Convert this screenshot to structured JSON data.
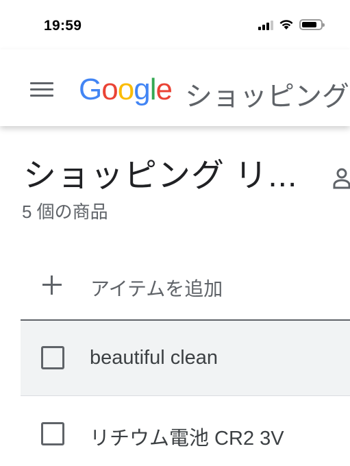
{
  "status_bar": {
    "time": "19:59"
  },
  "app_bar": {
    "logo_letters": [
      "G",
      "o",
      "o",
      "g",
      "l",
      "e"
    ],
    "title": "ショッピング"
  },
  "list": {
    "title": "ショッピング リ...",
    "item_count": "5 個の商品",
    "add_item_placeholder": "アイテムを追加",
    "items": [
      {
        "label": "beautiful clean",
        "checked": false
      },
      {
        "label": "リチウム電池 CR2 3V",
        "checked": false
      }
    ]
  },
  "colors": {
    "google_blue": "#4285f4",
    "google_red": "#ea4335",
    "google_yellow": "#fbbc05",
    "google_green": "#34a853",
    "icon_gray": "#5f6368",
    "highlight_row": "#f1f3f4"
  },
  "icons": [
    "signal-icon",
    "wifi-icon",
    "battery-icon",
    "menu-icon",
    "share-person-icon",
    "plus-icon",
    "checkbox-icon"
  ]
}
